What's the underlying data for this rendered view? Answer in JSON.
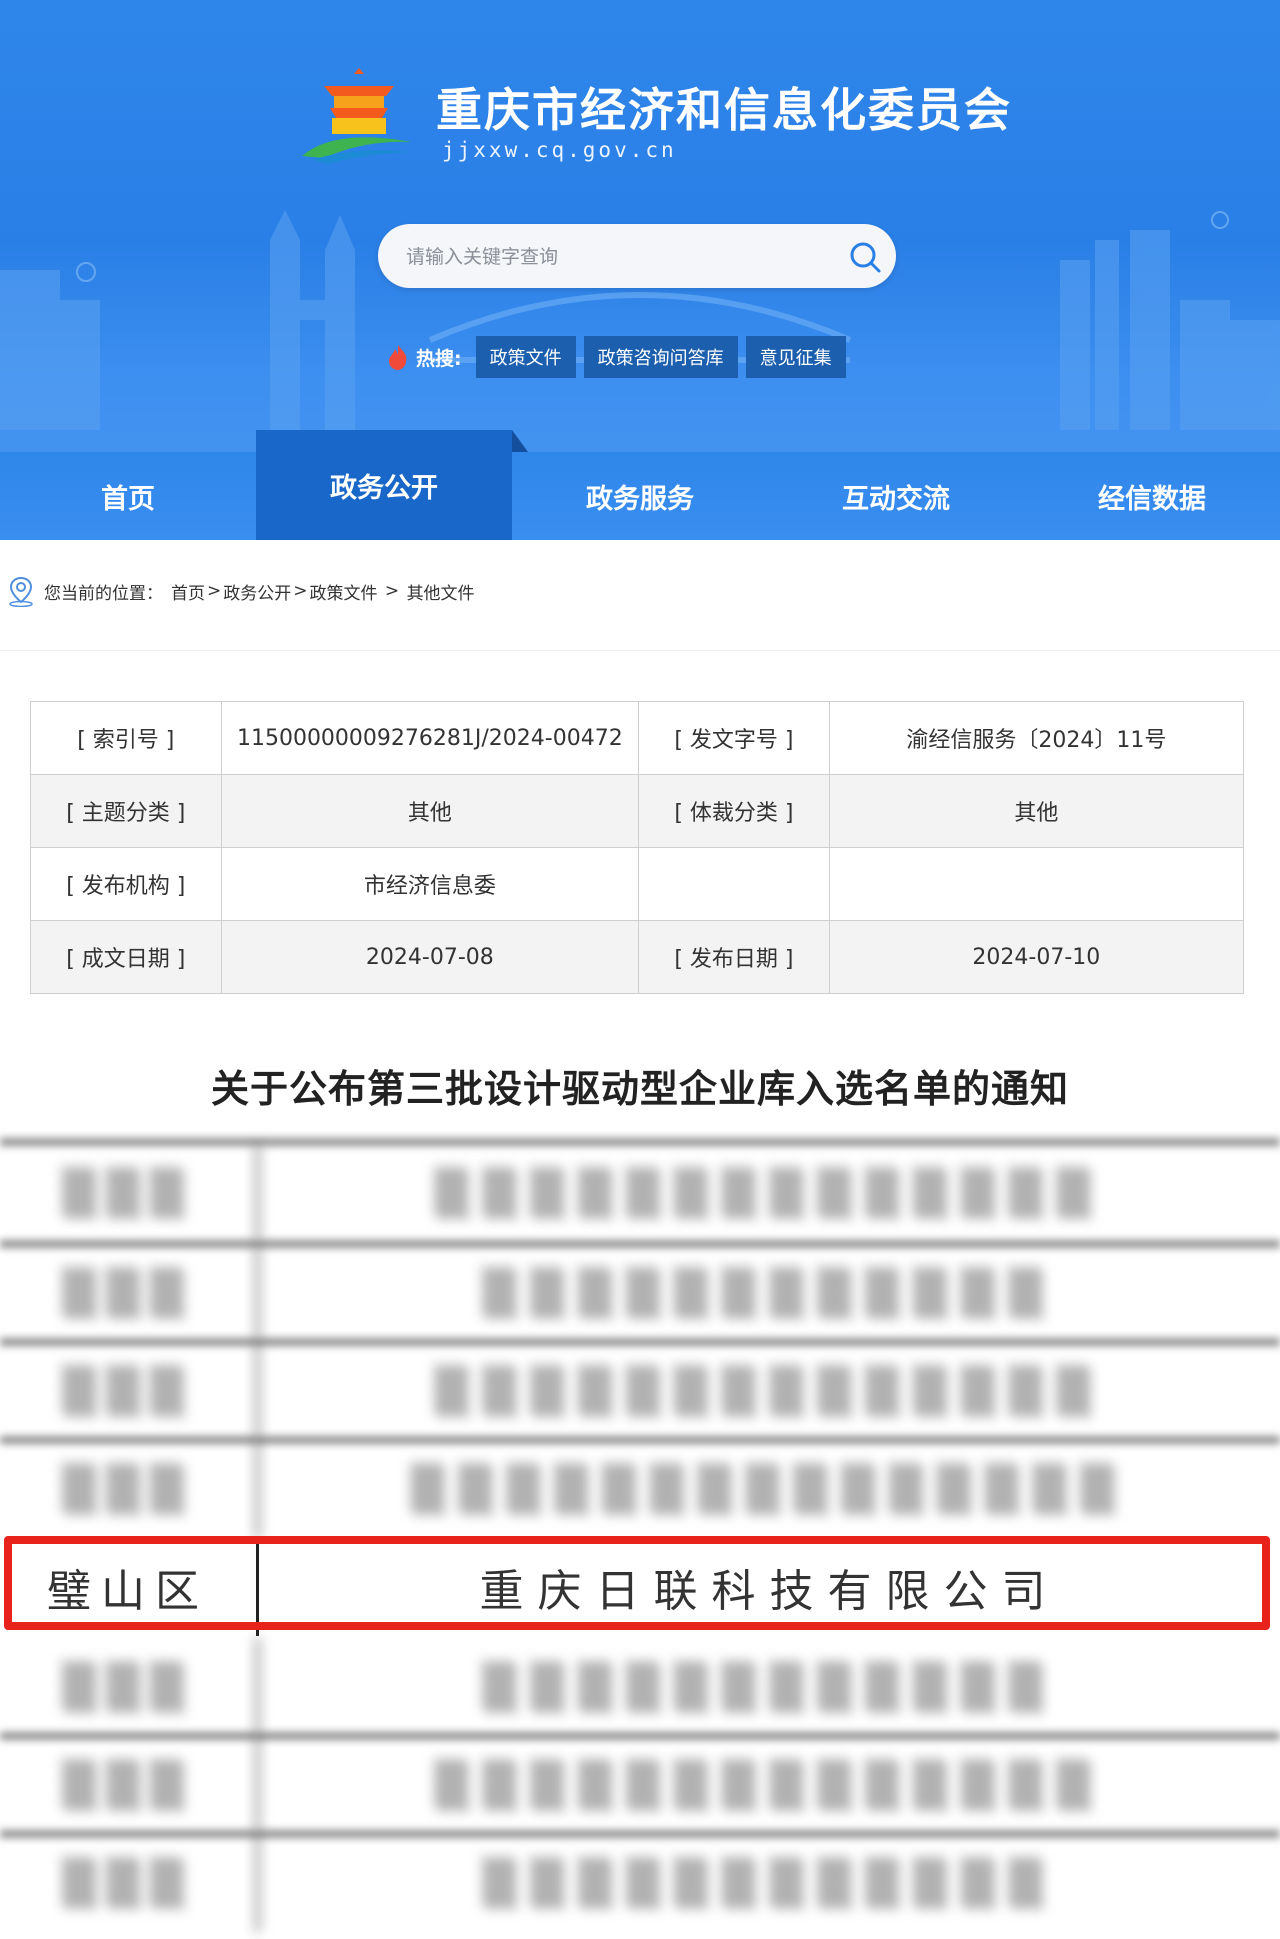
{
  "header": {
    "site_title": "重庆市经济和信息化委员会",
    "site_url": "jjxxw.cq.gov.cn",
    "search_placeholder": "请输入关键字查询",
    "hot_label": "热搜:",
    "hot_tags": [
      "政策文件",
      "政策咨询问答库",
      "意见征集"
    ]
  },
  "nav": {
    "items": [
      "首页",
      "政务公开",
      "政务服务",
      "互动交流",
      "经信数据"
    ],
    "active": "政务公开"
  },
  "breadcrumb": {
    "prefix": "您当前的位置：",
    "items": [
      "首页",
      "政务公开",
      "政策文件",
      "其他文件"
    ]
  },
  "meta": {
    "rows": [
      {
        "label1": "[ 索引号 ]",
        "value1": "11500000009276281J/2024-00472",
        "label2": "[ 发文字号 ]",
        "value2": "渝经信服务〔2024〕11号"
      },
      {
        "label1": "[ 主题分类 ]",
        "value1": "其他",
        "label2": "[ 体裁分类 ]",
        "value2": "其他"
      },
      {
        "label1": "[ 发布机构 ]",
        "value1": "市经济信息委",
        "label2": "",
        "value2": ""
      },
      {
        "label1": "[ 成文日期 ]",
        "value1": "2024-07-08",
        "label2": "[ 发布日期 ]",
        "value2": "2024-07-10"
      }
    ]
  },
  "document": {
    "title": "关于公布第三批设计驱动型企业库入选名单的通知"
  },
  "list": {
    "highlighted": {
      "district": "璧山区",
      "company": "重庆日联科技有限公司"
    }
  },
  "colors": {
    "header_blue": "#2f86ea",
    "nav_active": "#1967c8",
    "tag_bg": "#1c5fae",
    "highlight_red": "#e8231c"
  }
}
